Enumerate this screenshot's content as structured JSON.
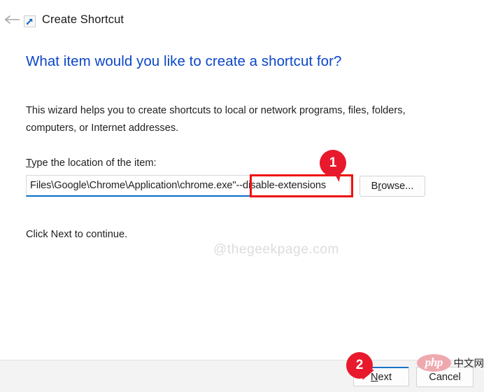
{
  "titlebar": {
    "back_label": "Back",
    "icon_name": "shortcut-arrow-icon",
    "title": "Create Shortcut"
  },
  "content": {
    "heading": "What item would you like to create a shortcut for?",
    "intro": "This wizard helps you to create shortcuts to local or network programs, files, folders, computers, or Internet addresses.",
    "field_label_accel": "T",
    "field_label_rest": "ype the location of the item:",
    "path_value": "Files\\Google\\Chrome\\Application\\chrome.exe\"",
    "path_arg": "--disable-extensions",
    "path_placeholder": "Type the location of the item",
    "browse_accel_before": "B",
    "browse_accel": "r",
    "browse_accel_after": "owse...",
    "click_next": "Click Next to continue.",
    "watermark": "@thegeekpage.com"
  },
  "annotations": {
    "badge_1": "1",
    "badge_2": "2",
    "accent_color": "#ee1111",
    "badge_color": "#e8192c"
  },
  "footer": {
    "next_accel": "N",
    "next_rest": "ext",
    "cancel_label": "Cancel"
  },
  "branding": {
    "php_text": "php",
    "cn_text": "中文网"
  },
  "colors": {
    "heading_blue": "#0b46c8",
    "focus_blue": "#0a6cca",
    "footer_bg": "#f3f3f3"
  }
}
